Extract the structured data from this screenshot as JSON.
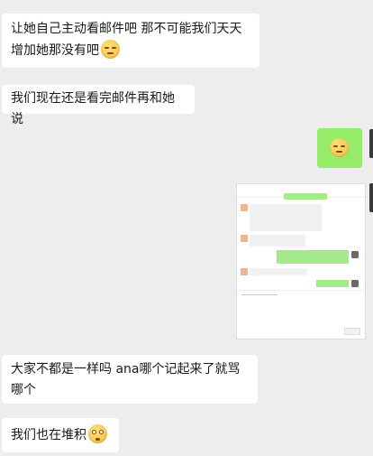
{
  "messages": [
    {
      "side": "left",
      "text": "让她自己主动看邮件吧 那不可能我们天天增加她那没有吧",
      "emoji": "grimace-emoji"
    },
    {
      "side": "left",
      "text": "我们现在还是看完邮件再和她说"
    },
    {
      "side": "right",
      "kind": "emoji",
      "emoji": "grimace-emoji"
    },
    {
      "side": "right",
      "kind": "image",
      "caption": "chat screenshot"
    },
    {
      "side": "left",
      "text": "大家不都是一样吗 ana哪个记起来了就骂哪个"
    },
    {
      "side": "left",
      "text": "我们也在堆积",
      "emoji": "flushed-emoji"
    }
  ],
  "colors": {
    "background": "#ededed",
    "bubble_in": "#ffffff",
    "bubble_out": "#95ec69"
  }
}
